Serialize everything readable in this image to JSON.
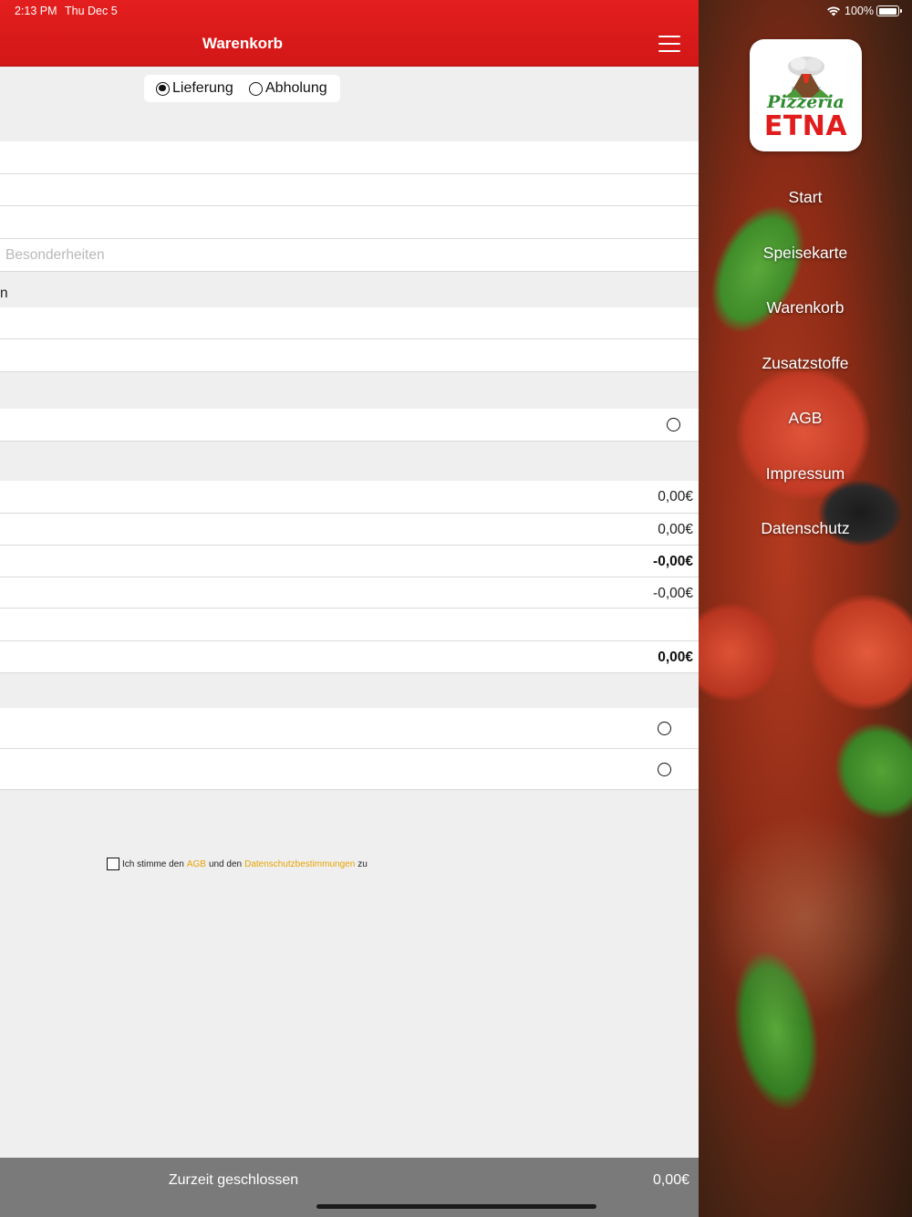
{
  "status_bar": {
    "time": "2:13 PM",
    "date": "Thu Dec 5",
    "battery": "100%"
  },
  "header": {
    "title": "Warenkorb",
    "menu_icon": "hamburger-menu-icon",
    "background": "#e01b1b"
  },
  "order_type": {
    "options": [
      "Lieferung",
      "Abholung"
    ],
    "selected": "Lieferung"
  },
  "address_form": {
    "notes_placeholder": "Besonderheiten",
    "section_label_fragment": "n"
  },
  "totals": {
    "line1": "0,00€",
    "line2": "0,00€",
    "line3": "-0,00€",
    "line4": "-0,00€",
    "total": "0,00€"
  },
  "terms": {
    "prefix": "Ich stimme den",
    "agb_link": "AGB",
    "middle": "und den",
    "privacy_link": "Datenschutzbestimmungen",
    "suffix": "zu",
    "link_color": "#e8a400"
  },
  "bottom_bar": {
    "status": "Zurzeit geschlossen",
    "total": "0,00€"
  },
  "side_menu": {
    "logo": {
      "script": "Pizzeria",
      "brand": "ETNA"
    },
    "items": [
      {
        "label": "Start"
      },
      {
        "label": "Speisekarte"
      },
      {
        "label": "Warenkorb"
      },
      {
        "label": "Zusatzstoffe"
      },
      {
        "label": "AGB"
      },
      {
        "label": "Impressum"
      },
      {
        "label": "Datenschutz"
      }
    ]
  }
}
